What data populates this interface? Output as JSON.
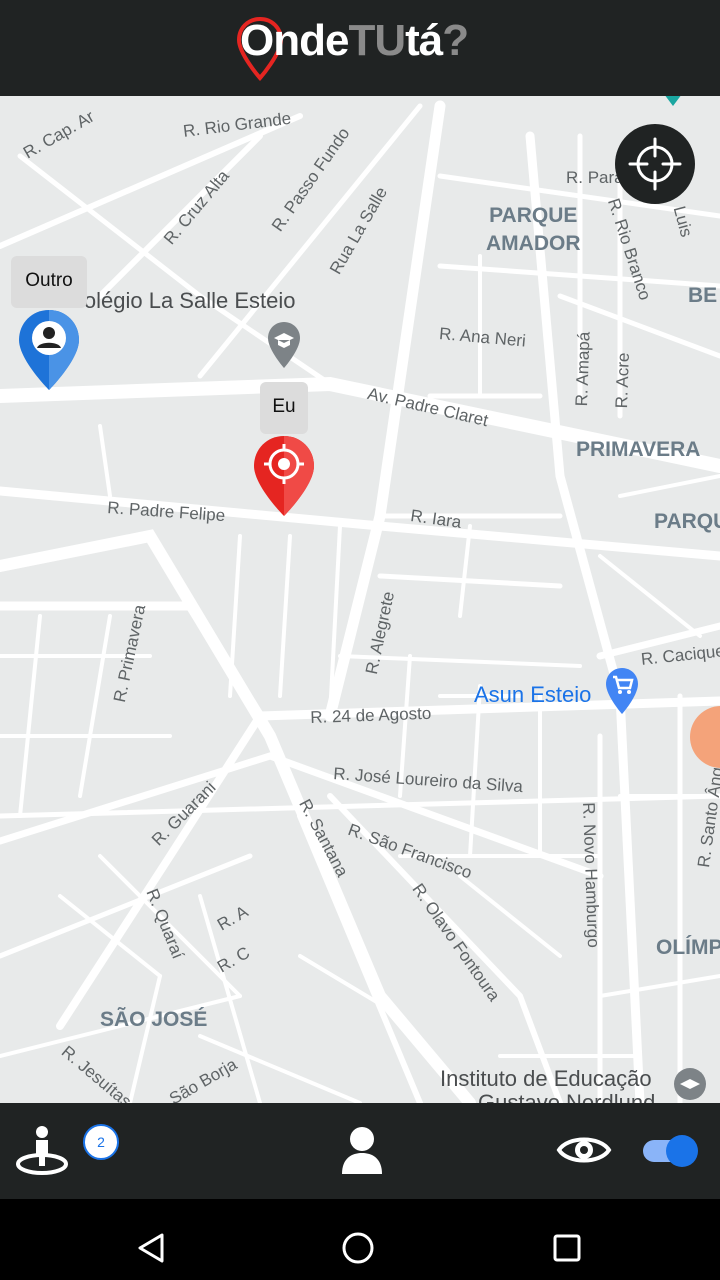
{
  "app": {
    "logo_parts": [
      "Onde",
      "T",
      "U",
      "tá",
      "?"
    ]
  },
  "map": {
    "streets": [
      "R. Cap. Ar",
      "R. Rio Grande",
      "R. Cruz Alta",
      "R. Passo Fundo",
      "Rua La Salle",
      "R. Para",
      "R. Rio Branco",
      "Luis",
      "R. Ana Neri",
      "R. Amapá",
      "R. Acre",
      "Av. Padre Claret",
      "R. Padre Felipe",
      "R. Iara",
      "R. Alegrete",
      "R. Primavera",
      "R. Cacique",
      "R. 24 de Agosto",
      "R. José Loureiro da Silva",
      "R. Guarani",
      "R. Santana",
      "R. São Francisco",
      "R. Olavo Fontoura",
      "R. Novo Hamburgo",
      "R. Santo Ângelo",
      "R. Quaraí",
      "R. A",
      "R. C",
      "R. Jesuítas",
      "São Borja"
    ],
    "districts": [
      "PARQUE\nAMADOR",
      "BE",
      "PRIMAVERA",
      "PARQU",
      "SÃO JOSÉ",
      "OLÍMP"
    ],
    "pois": [
      "Colégio La Salle Esteio",
      "Asun Esteio",
      "Instituto de Educação",
      "Gustavo Nordlund"
    ]
  },
  "markers": {
    "other_label": "Outro",
    "me_label": "Eu"
  },
  "bottom_bar": {
    "people_count": "2"
  },
  "colors": {
    "header_bg": "#202323",
    "map_bg": "#e8eaea",
    "accent": "#1a73e8",
    "me_marker": "#e52521",
    "other_marker": "#1e73d8"
  },
  "icons": [
    "locate-crosshair-icon",
    "person-pin-icon",
    "target-pin-icon",
    "user-location-icon",
    "user-icon",
    "eye-icon",
    "back-icon",
    "home-icon",
    "recents-icon"
  ]
}
